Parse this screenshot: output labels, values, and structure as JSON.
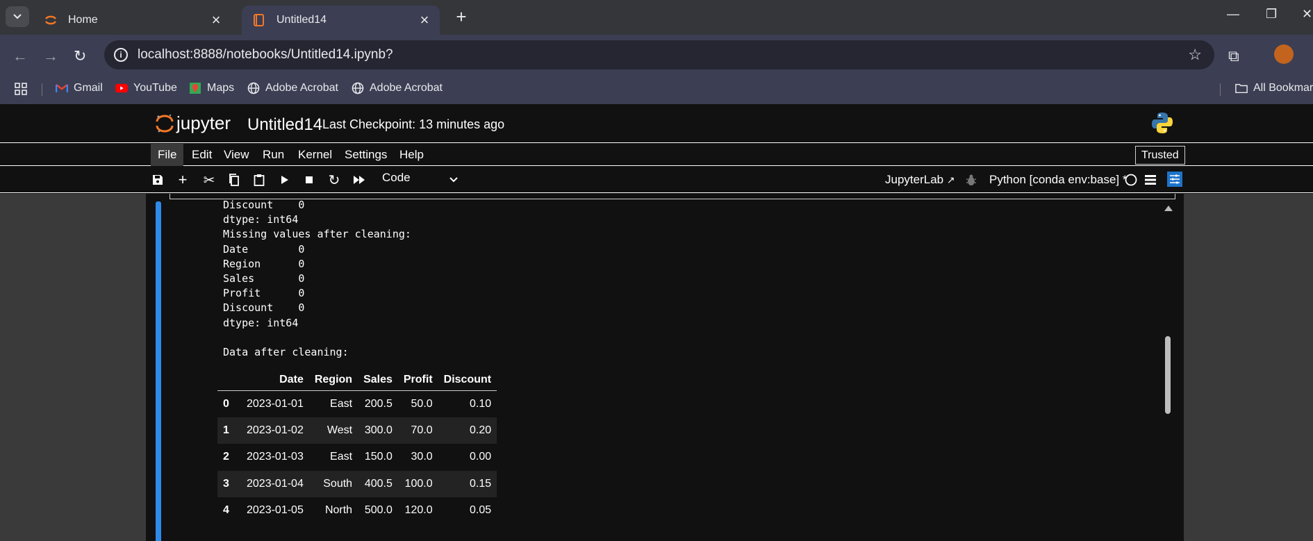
{
  "browser": {
    "tabs": [
      {
        "title": "Home",
        "active": false
      },
      {
        "title": "Untitled14",
        "active": true
      }
    ],
    "url": "localhost:8888/notebooks/Untitled14.ipynb?",
    "bookmarks": [
      "Gmail",
      "YouTube",
      "Maps",
      "Adobe Acrobat",
      "Adobe Acrobat"
    ],
    "all_bookmarks": "All Bookmarks"
  },
  "jupyter": {
    "logo_text": "jupyter",
    "notebook_name": "Untitled14",
    "checkpoint": "Last Checkpoint: 13 minutes ago",
    "menu": [
      "File",
      "Edit",
      "View",
      "Run",
      "Kernel",
      "Settings",
      "Help"
    ],
    "trusted": "Trusted",
    "cell_type": "Code",
    "jupyterlab_link": "JupyterLab",
    "kernel": "Python [conda env:base] *",
    "accent_color": "#2f89e8"
  },
  "output": {
    "text": "Discount    0\ndtype: int64\nMissing values after cleaning:\nDate        0\nRegion      0\nSales       0\nProfit      0\nDiscount    0\ndtype: int64\n\nData after cleaning:",
    "table": {
      "columns": [
        "",
        "Date",
        "Region",
        "Sales",
        "Profit",
        "Discount"
      ],
      "rows": [
        [
          "0",
          "2023-01-01",
          "East",
          "200.5",
          "50.0",
          "0.10"
        ],
        [
          "1",
          "2023-01-02",
          "West",
          "300.0",
          "70.0",
          "0.20"
        ],
        [
          "2",
          "2023-01-03",
          "East",
          "150.0",
          "30.0",
          "0.00"
        ],
        [
          "3",
          "2023-01-04",
          "South",
          "400.5",
          "100.0",
          "0.15"
        ],
        [
          "4",
          "2023-01-05",
          "North",
          "500.0",
          "120.0",
          "0.05"
        ]
      ]
    }
  }
}
